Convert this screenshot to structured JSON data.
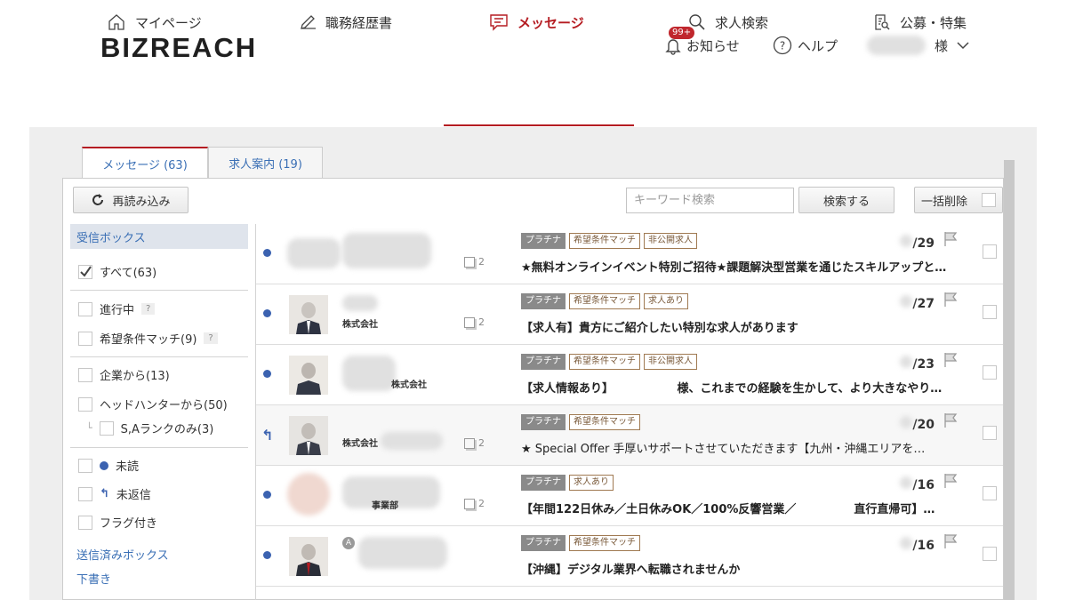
{
  "header": {
    "logo": "BIZREACH",
    "notice_badge": "99+",
    "notice_label": "お知らせ",
    "help_label": "ヘルプ",
    "user_suffix": "様"
  },
  "nav": {
    "mypage": "マイページ",
    "resume": "職務経歴書",
    "messages": "メッセージ",
    "job_search": "求人検索",
    "public": "公募・特集"
  },
  "tabs": {
    "messages": "メッセージ (63)",
    "jobs": "求人案内 (19)"
  },
  "toolbar": {
    "reload": "再読み込み",
    "search_placeholder": "キーワード検索",
    "search_button": "検索する",
    "bulk_delete": "一括削除"
  },
  "sidebar": {
    "inbox": "受信ボックス",
    "all": "すべて(63)",
    "in_progress": "進行中",
    "match": "希望条件マッチ(9)",
    "from_company": "企業から(13)",
    "from_headhunter": "ヘッドハンターから(50)",
    "sa_rank": "S,Aランクのみ(3)",
    "unread": "未読",
    "unreplied": "未返信",
    "flagged": "フラグ付き",
    "help_mark": "?",
    "sent": "送信済みボックス",
    "drafts": "下書き"
  },
  "messages": [
    {
      "company": "",
      "count": "2",
      "tags": [
        "プラチナ",
        "希望条件マッチ",
        "非公開求人"
      ],
      "date": "/29",
      "subject": "★無料オンラインイベント特別ご招待★課題解決型営業を通じたスキルアップと…",
      "status": "unread"
    },
    {
      "company": "株式会社",
      "count": "2",
      "tags": [
        "プラチナ",
        "希望条件マッチ",
        "求人あり"
      ],
      "date": "/27",
      "subject": "【求人有】貴方にご紹介したい特別な求人があります",
      "status": "unread"
    },
    {
      "company": "株式会社",
      "count": "",
      "tags": [
        "プラチナ",
        "希望条件マッチ",
        "非公開求人"
      ],
      "date": "/23",
      "subject": "【求人情報あり】　　　　　　様、これまでの経験を生かして、より大きなやり…",
      "status": "unread"
    },
    {
      "company": "株式会社",
      "count": "2",
      "tags": [
        "プラチナ",
        "希望条件マッチ"
      ],
      "date": "/20",
      "subject": "★ Special Offer 手厚いサポートさせていただきます【九州・沖縄エリアを…",
      "status": "replied"
    },
    {
      "company": "事業部",
      "count": "2",
      "tags": [
        "プラチナ",
        "求人あり"
      ],
      "date": "/16",
      "subject": "【年間122日休み／土日休みOK／100%反響営業／　　　　　直行直帰可】…",
      "status": "unread"
    },
    {
      "company": "",
      "count": "",
      "tags": [
        "プラチナ",
        "希望条件マッチ"
      ],
      "date": "/16",
      "subject": "【沖縄】デジタル業界へ転職されませんか",
      "status": "unread"
    }
  ],
  "colors": {
    "brand": "#b51c22",
    "link": "#3a6fb5",
    "unread_dot": "#3b62b0"
  }
}
